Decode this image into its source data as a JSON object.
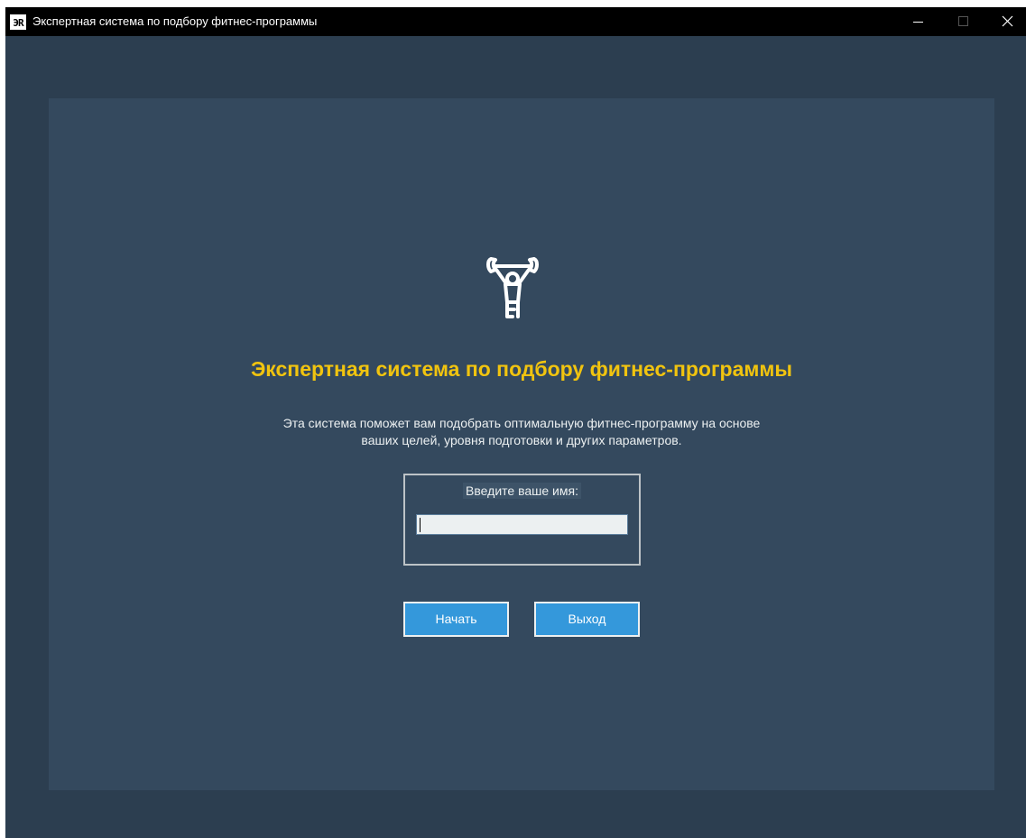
{
  "window": {
    "title": "Экспертная система по подбору фитнес-программы",
    "icon_label": "ЭR"
  },
  "main": {
    "heading": "Экспертная система по подбору фитнес-программы",
    "description_line1": "Эта система поможет вам подобрать оптимальную фитнес-программу на основе",
    "description_line2": "ваших целей, уровня подготовки и других параметров.",
    "name_label": "Введите ваше имя:",
    "name_value": "",
    "start_label": "Начать",
    "exit_label": "Выход"
  },
  "icons": {
    "logo": "weightlifter-icon",
    "minimize": "minimize-icon",
    "maximize": "maximize-icon",
    "close": "close-icon"
  },
  "colors": {
    "window_bg": "#2c3e50",
    "panel_bg": "#34495e",
    "heading": "#f1c40f",
    "button": "#3498db",
    "text": "#ecf0f1"
  }
}
